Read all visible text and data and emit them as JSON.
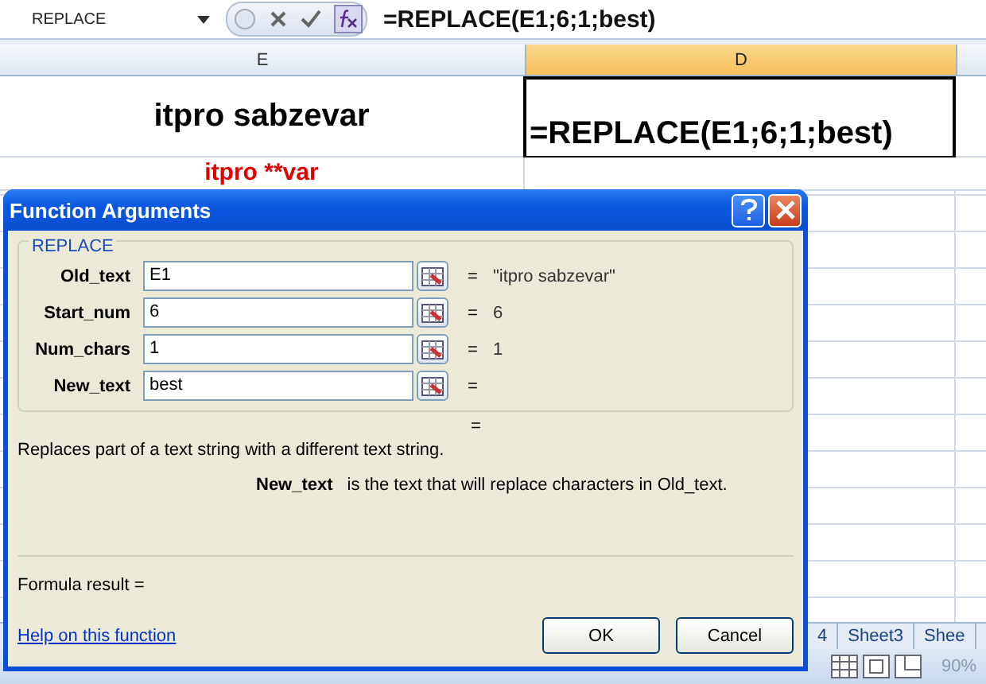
{
  "formula_bar": {
    "name_box": "REPLACE",
    "formula": "=REPLACE(E1;6;1;best)"
  },
  "columns": [
    {
      "label": "E",
      "selected": false
    },
    {
      "label": "D",
      "selected": true
    }
  ],
  "rows": [
    {
      "cells": [
        {
          "text": "itpro sabzevar",
          "kind": "title"
        },
        {
          "text": "=REPLACE(E1;6;1;best)",
          "kind": "active"
        }
      ]
    },
    {
      "cells": [
        {
          "text": "itpro **var",
          "kind": "result"
        }
      ]
    }
  ],
  "dialog": {
    "title": "Function Arguments",
    "group": "REPLACE",
    "arguments": [
      {
        "label": "Old_text",
        "value": "E1",
        "equals": "=",
        "result": "\"itpro sabzevar\""
      },
      {
        "label": "Start_num",
        "value": "6",
        "equals": "=",
        "result": "6"
      },
      {
        "label": "Num_chars",
        "value": "1",
        "equals": "=",
        "result": "1"
      },
      {
        "label": "New_text",
        "value": "best",
        "equals": "="
      }
    ],
    "total_equals": "=",
    "description": "Replaces part of a text string with a different text string.",
    "argument_help": {
      "name": "New_text",
      "text": "is the text that will replace characters in Old_text."
    },
    "formula_result": "Formula result =",
    "help_link": "Help on this function",
    "buttons": [
      "OK",
      "Cancel"
    ]
  },
  "sheet_tabs": [
    "4",
    "Sheet3",
    "Shee"
  ],
  "zoom": "90%"
}
